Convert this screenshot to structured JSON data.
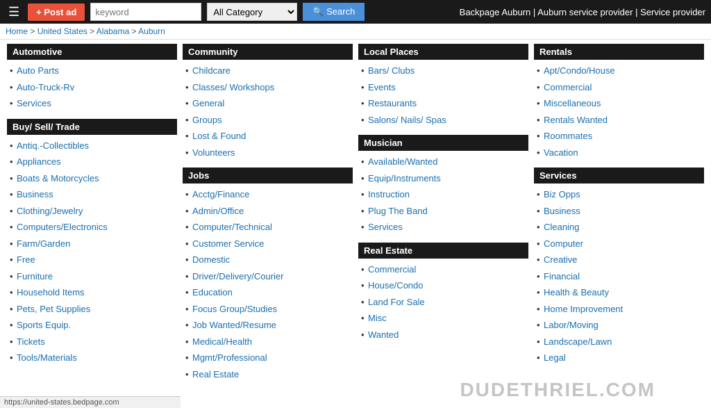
{
  "header": {
    "post_ad_label": "+ Post ad",
    "keyword_placeholder": "keyword",
    "search_label": "Search",
    "site_title": "Backpage Auburn | Auburn service provider | Service provider",
    "category_default": "All Category"
  },
  "breadcrumb": {
    "items": [
      "Home",
      "United States",
      "Alabama",
      "Auburn"
    ],
    "separator": " > "
  },
  "columns": [
    {
      "sections": [
        {
          "title": "Automotive",
          "links": [
            "Auto Parts",
            "Auto-Truck-Rv",
            "Services"
          ]
        },
        {
          "title": "Buy/ Sell/ Trade",
          "links": [
            "Antiq.-Collectibles",
            "Appliances",
            "Boats & Motorcycles",
            "Business",
            "Clothing/Jewelry",
            "Computers/Electronics",
            "Farm/Garden",
            "Free",
            "Furniture",
            "Household Items",
            "Pets, Pet Supplies",
            "Sports Equip.",
            "Tickets",
            "Tools/Materials"
          ]
        }
      ]
    },
    {
      "sections": [
        {
          "title": "Community",
          "links": [
            "Childcare",
            "Classes/ Workshops",
            "General",
            "Groups",
            "Lost & Found",
            "Volunteers"
          ]
        },
        {
          "title": "Jobs",
          "links": [
            "Acctg/Finance",
            "Admin/Office",
            "Computer/Technical",
            "Customer Service",
            "Domestic",
            "Driver/Delivery/Courier",
            "Education",
            "Focus Group/Studies",
            "Job Wanted/Resume",
            "Medical/Health",
            "Mgmt/Professional",
            "Real Estate"
          ]
        }
      ]
    },
    {
      "sections": [
        {
          "title": "Local Places",
          "links": [
            "Bars/ Clubs",
            "Events",
            "Restaurants",
            "Salons/ Nails/ Spas"
          ]
        },
        {
          "title": "Musician",
          "links": [
            "Available/Wanted",
            "Equip/Instruments",
            "Instruction",
            "Plug The Band",
            "Services"
          ]
        },
        {
          "title": "Real Estate",
          "links": [
            "Commercial",
            "House/Condo",
            "Land For Sale",
            "Misc",
            "Wanted"
          ]
        }
      ]
    },
    {
      "sections": [
        {
          "title": "Rentals",
          "links": [
            "Apt/Condo/House",
            "Commercial",
            "Miscellaneous",
            "Rentals Wanted",
            "Roommates",
            "Vacation"
          ]
        },
        {
          "title": "Services",
          "links": [
            "Biz Opps",
            "Business",
            "Cleaning",
            "Computer",
            "Creative",
            "Financial",
            "Health & Beauty",
            "Home Improvement",
            "Labor/Moving",
            "Landscape/Lawn",
            "Legal"
          ]
        }
      ]
    }
  ],
  "watermark": "DUDETHRIEL.COM",
  "status_bar_url": "https://united-states.bedpage.com"
}
